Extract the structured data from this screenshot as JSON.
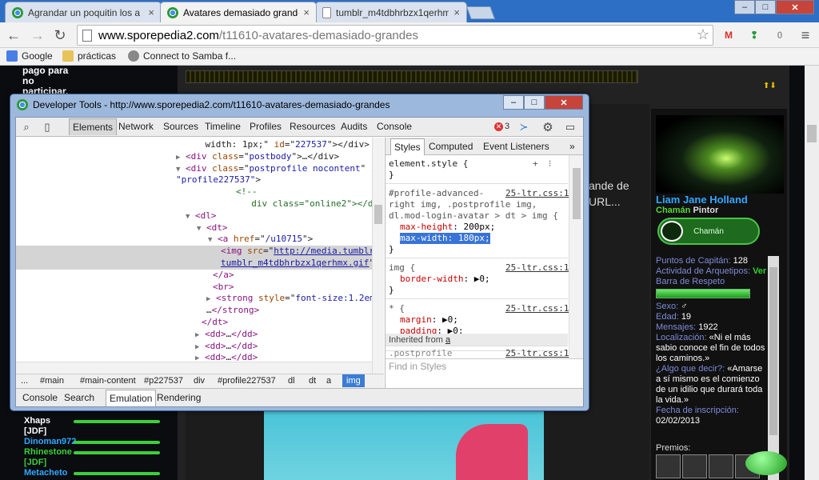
{
  "browser": {
    "tabs": [
      {
        "label": "Agrandar un poquitin los a",
        "active": false
      },
      {
        "label": "Avatares demasiado grande",
        "active": true
      },
      {
        "label": "tumblr_m4tdbhrbzx1qerhm",
        "active": false
      }
    ],
    "close_glyph": "×",
    "window_controls": {
      "minimize": "–",
      "maximize": "□",
      "close": "✕"
    },
    "url_host": "www.sporepedia2.com",
    "url_path": "/t11610-avatares-demasiado-grandes",
    "nav_icons": {
      "back": "←",
      "forward": "→",
      "reload": "↻",
      "star": "☆",
      "menu": "≡"
    },
    "extensions": {
      "gmail": "M",
      "evernote": "❢",
      "office": "0"
    },
    "bookmarks": [
      "Google",
      "prácticas",
      "Connect to Samba f..."
    ],
    "colors": {
      "tabstrip": "#2d6fc4",
      "toolbar": "#f2f2f2"
    }
  },
  "page": {
    "left_top": [
      "pago para",
      "no",
      "participar."
    ],
    "post_text": [
      "ande de",
      "URL..."
    ],
    "arrows": "⬆⬇",
    "user": {
      "name": "Liam Jane Holland",
      "rank1": "Chamán",
      "rank2": "Pintor",
      "badge": "Chamán",
      "stats": [
        {
          "k": "Puntos de Capitán",
          "v": "128",
          "style": "b"
        },
        {
          "k": "Actividad de Arquetipos",
          "v": "Ver",
          "style": "g"
        },
        {
          "k": "Barra de Respeto",
          "v": "",
          "style": "b"
        }
      ],
      "respect_fill": 1.0,
      "stats2": [
        {
          "k": "Sexo",
          "v": "♂"
        },
        {
          "k": "Edad",
          "v": "19"
        },
        {
          "k": "Mensajes",
          "v": "1922"
        },
        {
          "k": "Localización",
          "v": "«Ni el más sabio conoce el fin de todos los caminos.»"
        },
        {
          "k": "¿Algo que decir?",
          "v": "«Amarse a sí mismo es el comienzo de un idilio que durará toda la vida.»"
        },
        {
          "k": "Fecha de inscripción",
          "v": "02/02/2013"
        }
      ],
      "premios": "Premios:"
    },
    "chat": [
      {
        "name": "Xhaps",
        "cls": "white",
        "line": true
      },
      {
        "name": "[JDF]",
        "cls": "white",
        "line": false
      },
      {
        "name": "Dinoman972",
        "cls": "blue",
        "line": true
      },
      {
        "name": "Rhinestone",
        "cls": "green",
        "line": true
      },
      {
        "name": "[JDF]",
        "cls": "green",
        "line": false
      },
      {
        "name": "Metacheto",
        "cls": "blue",
        "line": true
      }
    ]
  },
  "devtools": {
    "title": "Developer Tools - http://www.sporepedia2.com/t11610-avatares-demasiado-grandes",
    "panel_tabs": [
      "Elements",
      "Network",
      "Sources",
      "Timeline",
      "Profiles",
      "Resources",
      "Audits",
      "Console"
    ],
    "active_tab": "Elements",
    "icons": {
      "search": "⌕",
      "device": "▯",
      "console_toggle": "≻",
      "gear": "⚙",
      "dock": "▭",
      "error": "✕"
    },
    "error_count": "3",
    "dom_lines": [
      {
        "indent": 0,
        "html": "<span class='p'>    width: 1px;\" </span><span class='a'>id</span><span class='p'>=\"</span><span class='v'>227537</span><span class='p'>\"&gt;&lt;/div&gt;</span>"
      },
      {
        "indent": 0,
        "html": "<span class='tri'>▶</span> <span class='t'>&lt;div </span><span class='a'>class</span><span class='p'>=\"</span><span class='v'>postbody</span><span class='p'>\"&gt;…&lt;/div&gt;</span>"
      },
      {
        "indent": 0,
        "html": "<span class='tri'>▼</span> <span class='t'>&lt;div </span><span class='a'>class</span><span class='p'>=\"</span><span class='v'>postprofile nocontent</span><span class='p'>\" </span><span class='a'>i</span>"
      },
      {
        "indent": 0,
        "html": "<span class='v'>\"profile227537\"</span><span class='p'>&gt;</span>"
      },
      {
        "indent": 0,
        "html": "<span class='c'>        &lt;!--</span>"
      },
      {
        "indent": 0,
        "html": "<span class='c'>          div class=\"online2\"&gt;&lt;/div&gt;--&gt;</span>"
      },
      {
        "indent": 0,
        "html": "<span class='tri'>▼</span> <span class='t'>&lt;dl&gt;</span>"
      },
      {
        "indent": 0,
        "html": "<span class='tri'>▼</span> <span class='t'>&lt;dt&gt;</span>"
      },
      {
        "indent": 0,
        "html": "<span class='tri'>▼</span> <span class='t'>&lt;a </span><span class='a'>href</span><span class='p'>=\"</span><span class='v'>/u10715</span><span class='p'>\"&gt;</span>"
      },
      {
        "indent": 0,
        "html": "<span class='t'>&lt;img </span><span class='a'>src</span><span class='p'>=\"</span><span class='lk'>http://media.tumblr</span>"
      },
      {
        "indent": 0,
        "html": "<span class='lk'>tumblr_m4tdbhrbzx1qerhmx.gif</span><span class='p'>\"</span>"
      },
      {
        "indent": 0,
        "html": "<span class='t'>&lt;/a&gt;</span>"
      },
      {
        "indent": 0,
        "html": "<span class='t'>&lt;br&gt;</span>"
      },
      {
        "indent": 0,
        "html": "<span class='tri'>▶</span> <span class='t'>&lt;strong </span><span class='a'>style</span><span class='p'>=\"</span><span class='v'>font-size:1.2em</span>"
      },
      {
        "indent": 0,
        "html": "<span class='p'>…</span><span class='t'>&lt;/strong&gt;</span>"
      },
      {
        "indent": 0,
        "html": "<span class='t'>&lt;/dt&gt;</span>"
      },
      {
        "indent": 0,
        "html": "<span class='tri'>▶</span> <span class='t'>&lt;dd&gt;</span><span class='p'>…</span><span class='t'>&lt;/dd&gt;</span>"
      },
      {
        "indent": 0,
        "html": "<span class='tri'>▶</span> <span class='t'>&lt;dd&gt;</span><span class='p'>…</span><span class='t'>&lt;/dd&gt;</span>"
      },
      {
        "indent": 0,
        "html": "<span class='tri'>▶</span> <span class='t'>&lt;dd&gt;</span><span class='p'>…</span><span class='t'>&lt;/dd&gt;</span>"
      }
    ],
    "breadcrumbs": [
      "...",
      "#main",
      "#main-content",
      "#p227537",
      "div",
      "#profile227537",
      "dl",
      "dt",
      "a",
      "img"
    ],
    "active_crumb": "img",
    "drawer_tabs": [
      "Console",
      "Search",
      "Emulation",
      "Rendering"
    ],
    "active_drawer": "Emulation",
    "styles_tabs": [
      "Styles",
      "Computed",
      "Event Listeners"
    ],
    "styles_more": "»",
    "style_tools": {
      "add": "+",
      "toggle": "⁝"
    },
    "rules": [
      {
        "selector": "element.style {",
        "lines": [],
        "close": "}",
        "src": ""
      },
      {
        "selector": "#profile-advanced-\nright img, .postprofile img,\ndl.mod-login-avatar > dt > img {",
        "lines": [
          {
            "prop": "max-height",
            "val": "200px;",
            "hl": false
          },
          {
            "prop": "max-width",
            "val": "180px;",
            "hl": true
          }
        ],
        "close": "}",
        "src": "25-ltr.css:1"
      },
      {
        "selector": "img {",
        "lines": [
          {
            "prop": "border-width",
            "val": "▶0;",
            "hl": false
          }
        ],
        "close": "}",
        "src": "25-ltr.css:1"
      },
      {
        "selector": "* {",
        "lines": [
          {
            "prop": "margin",
            "val": "▶0;",
            "hl": false
          },
          {
            "prop": "padding",
            "val": "▶0;",
            "hl": false
          }
        ],
        "close": "}",
        "src": "25-ltr.css:1"
      }
    ],
    "inherited_label": "Inherited from",
    "inherited_el": "a",
    "trailing_selector": ".postprofile",
    "trailing_src": "25-ltr.css:1",
    "find_placeholder": "Find in Styles"
  }
}
